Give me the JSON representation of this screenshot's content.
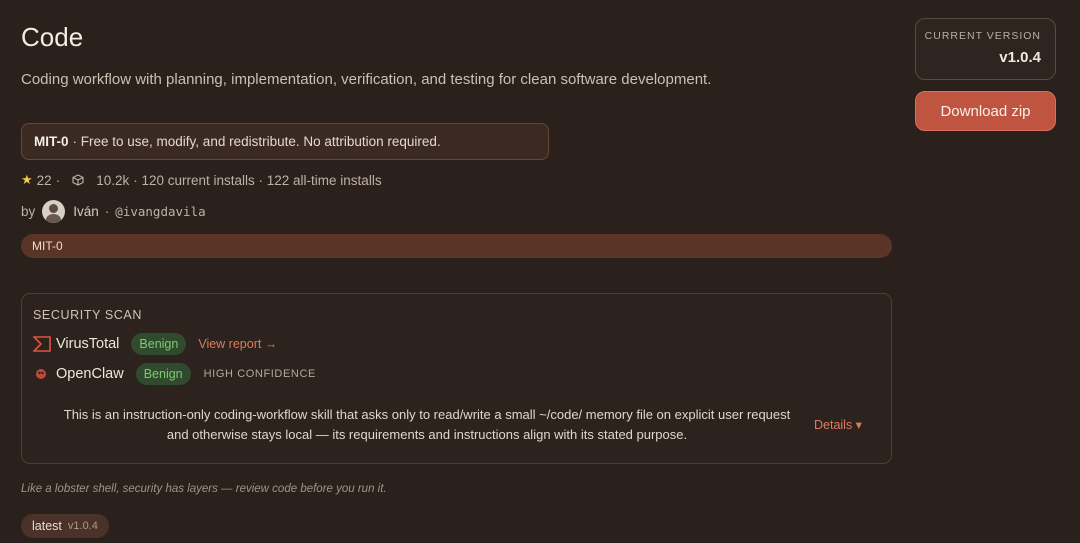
{
  "header": {
    "title": "Code",
    "subtitle": "Coding workflow with planning, implementation, verification, and testing for clean software development."
  },
  "license": {
    "name": "MIT-0",
    "description": "· Free to use, modify, and redistribute. No attribution required."
  },
  "stats": {
    "stars": "22",
    "stars_sep": "·",
    "downloads": "10.2k",
    "installs": "· 120 current installs · 122 all-time installs"
  },
  "author": {
    "by": "by",
    "name": "Iván",
    "sep": "·",
    "handle": "@ivangdavila"
  },
  "tag": "MIT-0",
  "security": {
    "title": "SECURITY SCAN",
    "virustotal": {
      "name": "VirusTotal",
      "verdict": "Benign",
      "link": "View report →"
    },
    "openclaw": {
      "name": "OpenClaw",
      "verdict": "Benign",
      "confidence": "HIGH CONFIDENCE"
    },
    "summary": "This is an instruction-only coding-workflow skill that asks only to read/write a small ~/code/ memory file on explicit user request and otherwise stays local — its requirements and instructions align with its stated purpose.",
    "details_label": "Details ▾"
  },
  "footnote": "Like a lobster shell, security has layers — review code before you run it.",
  "latest_tag": {
    "label": "latest",
    "version": "v1.0.4"
  },
  "sidebar": {
    "version_label": "CURRENT VERSION",
    "version_value": "v1.0.4",
    "download_label": "Download zip"
  },
  "colors": {
    "background": "#2a211d",
    "accent": "#bf5540",
    "benign_text": "#7dcb72",
    "link": "#e07a5f"
  }
}
